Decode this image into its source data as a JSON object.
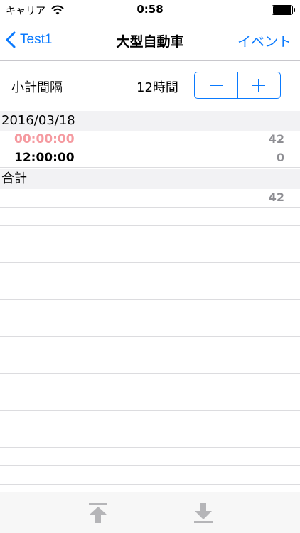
{
  "status": {
    "carrier": "キャリア",
    "time": "0:58"
  },
  "nav": {
    "back_label": "Test1",
    "title": "大型自動車",
    "right_label": "イベント"
  },
  "interval": {
    "label": "小計間隔",
    "value": "12時間"
  },
  "sections": [
    {
      "header": "2016/03/18",
      "rows": [
        {
          "time": "00:00:00",
          "count": "42"
        },
        {
          "time": "12:00:00",
          "count": "0"
        }
      ]
    },
    {
      "header": "合計",
      "rows": [
        {
          "time": "",
          "count": "42"
        }
      ]
    }
  ],
  "icons": {
    "back": "chevron-left-icon",
    "minus": "minus-icon",
    "plus": "plus-icon",
    "upload": "arrow-up-to-line-icon",
    "download": "arrow-down-to-line-icon"
  },
  "colors": {
    "accent": "#0a7afe",
    "highlight_time": "#f59aa0",
    "count_text": "#8e8e93",
    "section_bg": "#f2f2f4"
  }
}
